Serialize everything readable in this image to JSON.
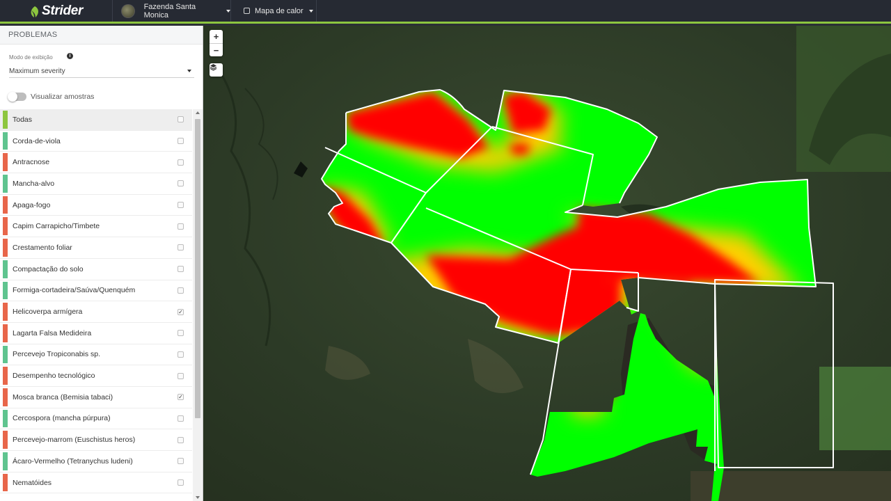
{
  "app": {
    "brand": "Strider"
  },
  "header": {
    "farm_name": "Fazenda Santa Monica",
    "heatmap_label": "Mapa de calor"
  },
  "sidebar": {
    "section_title": "PROBLEMAS",
    "mode_label": "Modo de exibição",
    "mode_value": "Maximum severity",
    "toggle_label": "Visualizar amostras",
    "toggle_on": false,
    "items": [
      {
        "label": "Todas",
        "color": "#8dc63f",
        "checked": false
      },
      {
        "label": "Corda-de-viola",
        "color": "#5fc48f",
        "checked": false
      },
      {
        "label": "Antracnose",
        "color": "#e8664a",
        "checked": false
      },
      {
        "label": "Mancha-alvo",
        "color": "#5fc48f",
        "checked": false
      },
      {
        "label": "Apaga-fogo",
        "color": "#e8664a",
        "checked": false
      },
      {
        "label": "Capim Carrapicho/Timbete",
        "color": "#e8664a",
        "checked": false
      },
      {
        "label": "Crestamento foliar",
        "color": "#e8664a",
        "checked": false
      },
      {
        "label": "Compactação do solo",
        "color": "#5fc48f",
        "checked": false
      },
      {
        "label": "Formiga-cortadeira/Saúva/Quenquém",
        "color": "#5fc48f",
        "checked": false
      },
      {
        "label": "Helicoverpa armígera",
        "color": "#e8664a",
        "checked": true
      },
      {
        "label": "Lagarta Falsa Medideira",
        "color": "#e8664a",
        "checked": false
      },
      {
        "label": "Percevejo Tropiconabis sp.",
        "color": "#5fc48f",
        "checked": false
      },
      {
        "label": "Desempenho tecnológico",
        "color": "#e8664a",
        "checked": false
      },
      {
        "label": "Mosca branca (Bemisia tabaci)",
        "color": "#e8664a",
        "checked": true
      },
      {
        "label": "Cercospora (mancha púrpura)",
        "color": "#5fc48f",
        "checked": false
      },
      {
        "label": "Percevejo-marrom (Euschistus heros)",
        "color": "#e8664a",
        "checked": false
      },
      {
        "label": "Ácaro-Vermelho (Tetranychus ludeni)",
        "color": "#5fc48f",
        "checked": false
      },
      {
        "label": "Nematóides",
        "color": "#e8664a",
        "checked": false
      }
    ]
  },
  "map": {
    "zoom_in": "+",
    "zoom_out": "−",
    "colors": {
      "high": "#ff0000",
      "mid": "#ffe000",
      "low": "#00ff00"
    }
  }
}
